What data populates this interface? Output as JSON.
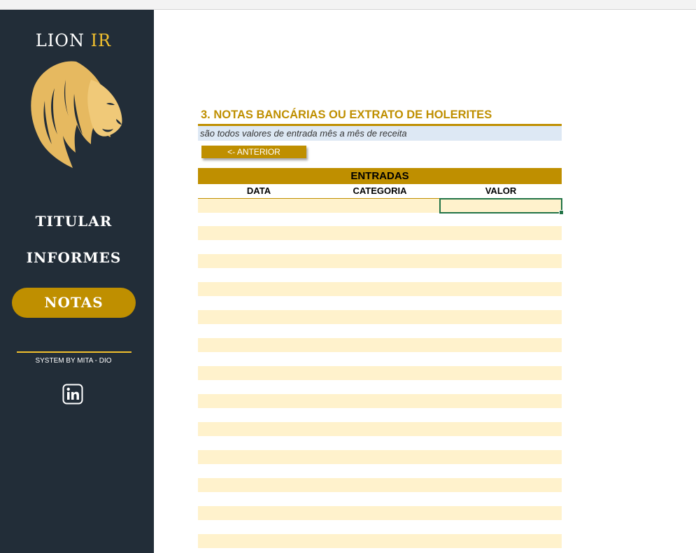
{
  "sidebar": {
    "brand_main": "LION",
    "brand_accent": "IR",
    "nav": [
      {
        "label": "TITULAR",
        "active": false
      },
      {
        "label": "INFORMES",
        "active": false
      },
      {
        "label": "NOTAS",
        "active": true
      }
    ],
    "credit": "SYSTEM BY MITA - DIO",
    "icons": {
      "logo": "lion-head-icon",
      "social": "linkedin-icon"
    }
  },
  "sheet": {
    "title": "3. NOTAS BANCÁRIAS OU EXTRATO DE HOLERITES",
    "subtitle": "são todos valores de entrada mês a mês de receita",
    "prev_button": "<- ANTERIOR",
    "table_title": "ENTRADAS",
    "columns": [
      "DATA",
      "CATEGORIA",
      "VALOR"
    ],
    "rows": []
  },
  "colors": {
    "sidebar_bg": "#222d38",
    "accent_gold": "#bf8f00",
    "brand_yellow": "#f2c02e",
    "row_band": "#fff2cc",
    "subtitle_band": "#dde8f4",
    "selection": "#217346"
  }
}
